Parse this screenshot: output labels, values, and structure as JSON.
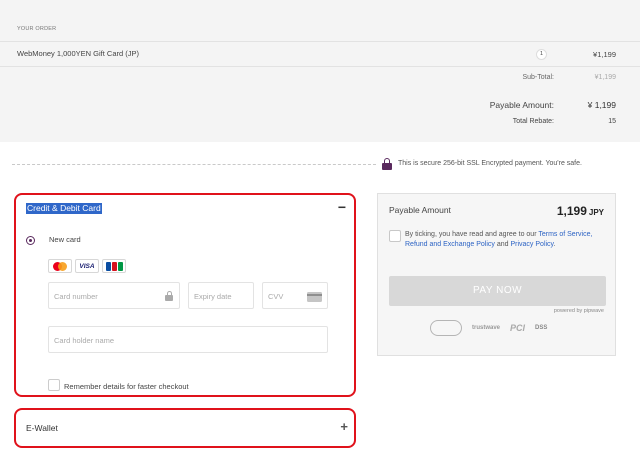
{
  "order": {
    "title": "YOUR ORDER",
    "item_name": "WebMoney 1,000YEN Gift Card (JP)",
    "item_qty": "1",
    "item_price": "¥1,199",
    "subtotal_label": "Sub-Total:",
    "subtotal_value": "¥1,199",
    "payable_label": "Payable Amount:",
    "payable_value": "¥ 1,199",
    "rebate_label": "Total Rebate:",
    "rebate_value": "15"
  },
  "secure": {
    "icon": "lock-icon",
    "text": "This is secure 256-bit SSL Encrypted payment. You're safe."
  },
  "card_section": {
    "title": "Credit & Debit Card",
    "toggle": "−",
    "new_card_label": "New card",
    "brands": [
      "mastercard",
      "VISA",
      "JCB"
    ],
    "card_number_placeholder": "Card number",
    "expiry_placeholder": "Expiry date",
    "cvv_placeholder": "CVV",
    "holder_placeholder": "Card holder name",
    "remember_label": "Remember details for faster checkout"
  },
  "ewallet": {
    "label": "E-Wallet",
    "toggle": "+"
  },
  "pay_panel": {
    "label": "Payable Amount",
    "amount": "1,199",
    "currency": "JPY",
    "terms_prefix": "By ticking, you have read and agree to our ",
    "terms_link": "Terms of Service, Refund and Exchange Policy",
    "terms_mid": " and ",
    "privacy_link": "Privacy Policy",
    "terms_suffix": ".",
    "pay_button": "PAY NOW",
    "powered_by": "powered by pipwave",
    "badges": [
      "secure-seal",
      "trustwave",
      "PCI",
      "DSS"
    ]
  },
  "colors": {
    "accent": "#5a2a5e",
    "highlight_border": "#e0121b",
    "link": "#2c63c4",
    "selection": "#2f67c9"
  }
}
